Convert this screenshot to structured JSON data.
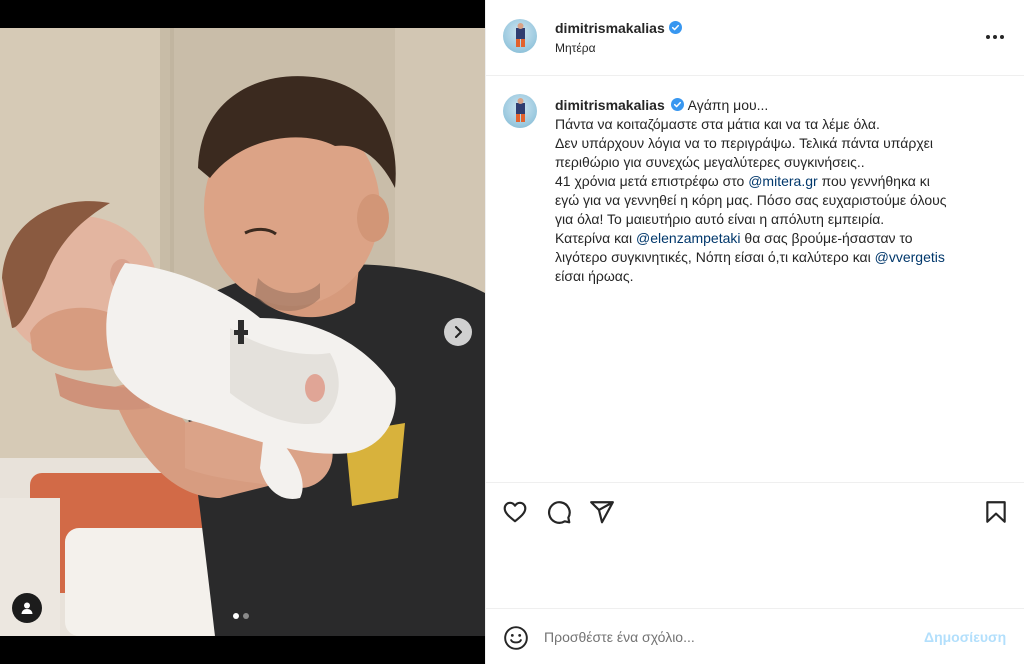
{
  "post": {
    "username": "dimitrismakalias",
    "location": "Μητέρα",
    "verified": true
  },
  "media": {
    "slide_count": 2,
    "active_slide": 1,
    "next_icon": "chevron-right-icon",
    "tag_icon": "user-tag-icon"
  },
  "caption": {
    "username": "dimitrismakalias",
    "lines": [
      {
        "pre": "Αγάπη μου...",
        "mention": "",
        "post": ""
      },
      {
        "pre": "Πάντα να κοιταζόμαστε στα μάτια και να τα λέμε όλα.",
        "mention": "",
        "post": ""
      },
      {
        "pre": "Δεν υπάρχουν λόγια να το περιγράψω. Τελικά πάντα υπάρχει",
        "mention": "",
        "post": ""
      },
      {
        "pre": "περιθώριο για συνεχώς μεγαλύτερες συγκινήσεις..",
        "mention": "",
        "post": ""
      },
      {
        "pre": "41 χρόνια μετά επιστρέφω στο ",
        "mention": "@mitera.gr",
        "post": " που γεννήθηκα κι"
      },
      {
        "pre": "εγώ για να γεννηθεί η κόρη μας. Πόσο σας ευχαριστούμε όλους",
        "mention": "",
        "post": ""
      },
      {
        "pre": "για όλα! Το μαιευτήριο αυτό είναι η απόλυτη εμπειρία.",
        "mention": "",
        "post": ""
      },
      {
        "pre": "Κατερίνα και ",
        "mention": "@elenzampetaki",
        "post": " θα σας βρούμε-ήσασταν το"
      },
      {
        "pre": "λιγότερο συγκινητικές, Νόπη είσαι ό,τι καλύτερο και ",
        "mention": "@vvergetis",
        "post": ""
      },
      {
        "pre": "είσαι ήρωας.",
        "mention": "",
        "post": ""
      }
    ]
  },
  "actions": {
    "icons": [
      "heart-icon",
      "comment-icon",
      "share-icon",
      "bookmark-icon"
    ]
  },
  "comment": {
    "placeholder": "Προσθέστε ένα σχόλιο...",
    "post_label": "Δημοσίευση",
    "emoji_icon": "smile-icon"
  },
  "colors": {
    "verified": "#3897f0",
    "mention": "#00376b",
    "post_button_disabled": "#b2dffc",
    "divider": "#efefef"
  }
}
